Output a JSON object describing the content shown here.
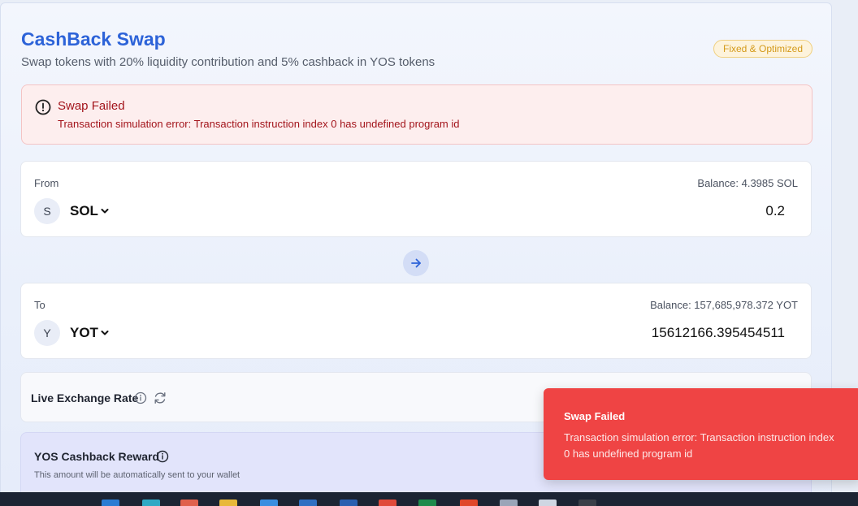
{
  "header": {
    "title": "CashBack Swap",
    "subtitle": "Swap tokens with 20% liquidity contribution and 5% cashback in YOS tokens",
    "badge": "Fixed & Optimized"
  },
  "alert": {
    "icon": "alert-circle-icon",
    "title": "Swap Failed",
    "message": "Transaction simulation error: Transaction instruction index 0 has undefined program id"
  },
  "from": {
    "label": "From",
    "balance": "Balance: 4.3985 SOL",
    "token_initial": "S",
    "token": "SOL",
    "amount": "0.2"
  },
  "to": {
    "label": "To",
    "balance": "Balance: 157,685,978.372 YOT",
    "token_initial": "Y",
    "token": "YOT",
    "amount": "15612166.395454511"
  },
  "rate": {
    "label": "Live Exchange Rate"
  },
  "cashback": {
    "title": "YOS Cashback Reward",
    "note": "This amount will be automatically sent to your wallet"
  },
  "toast": {
    "title": "Swap Failed",
    "message": "Transaction simulation error: Transaction instruction index 0 has undefined program id"
  },
  "colors": {
    "accent": "#2d63d8",
    "error": "#ef4444",
    "badge": "#d49a1a"
  }
}
